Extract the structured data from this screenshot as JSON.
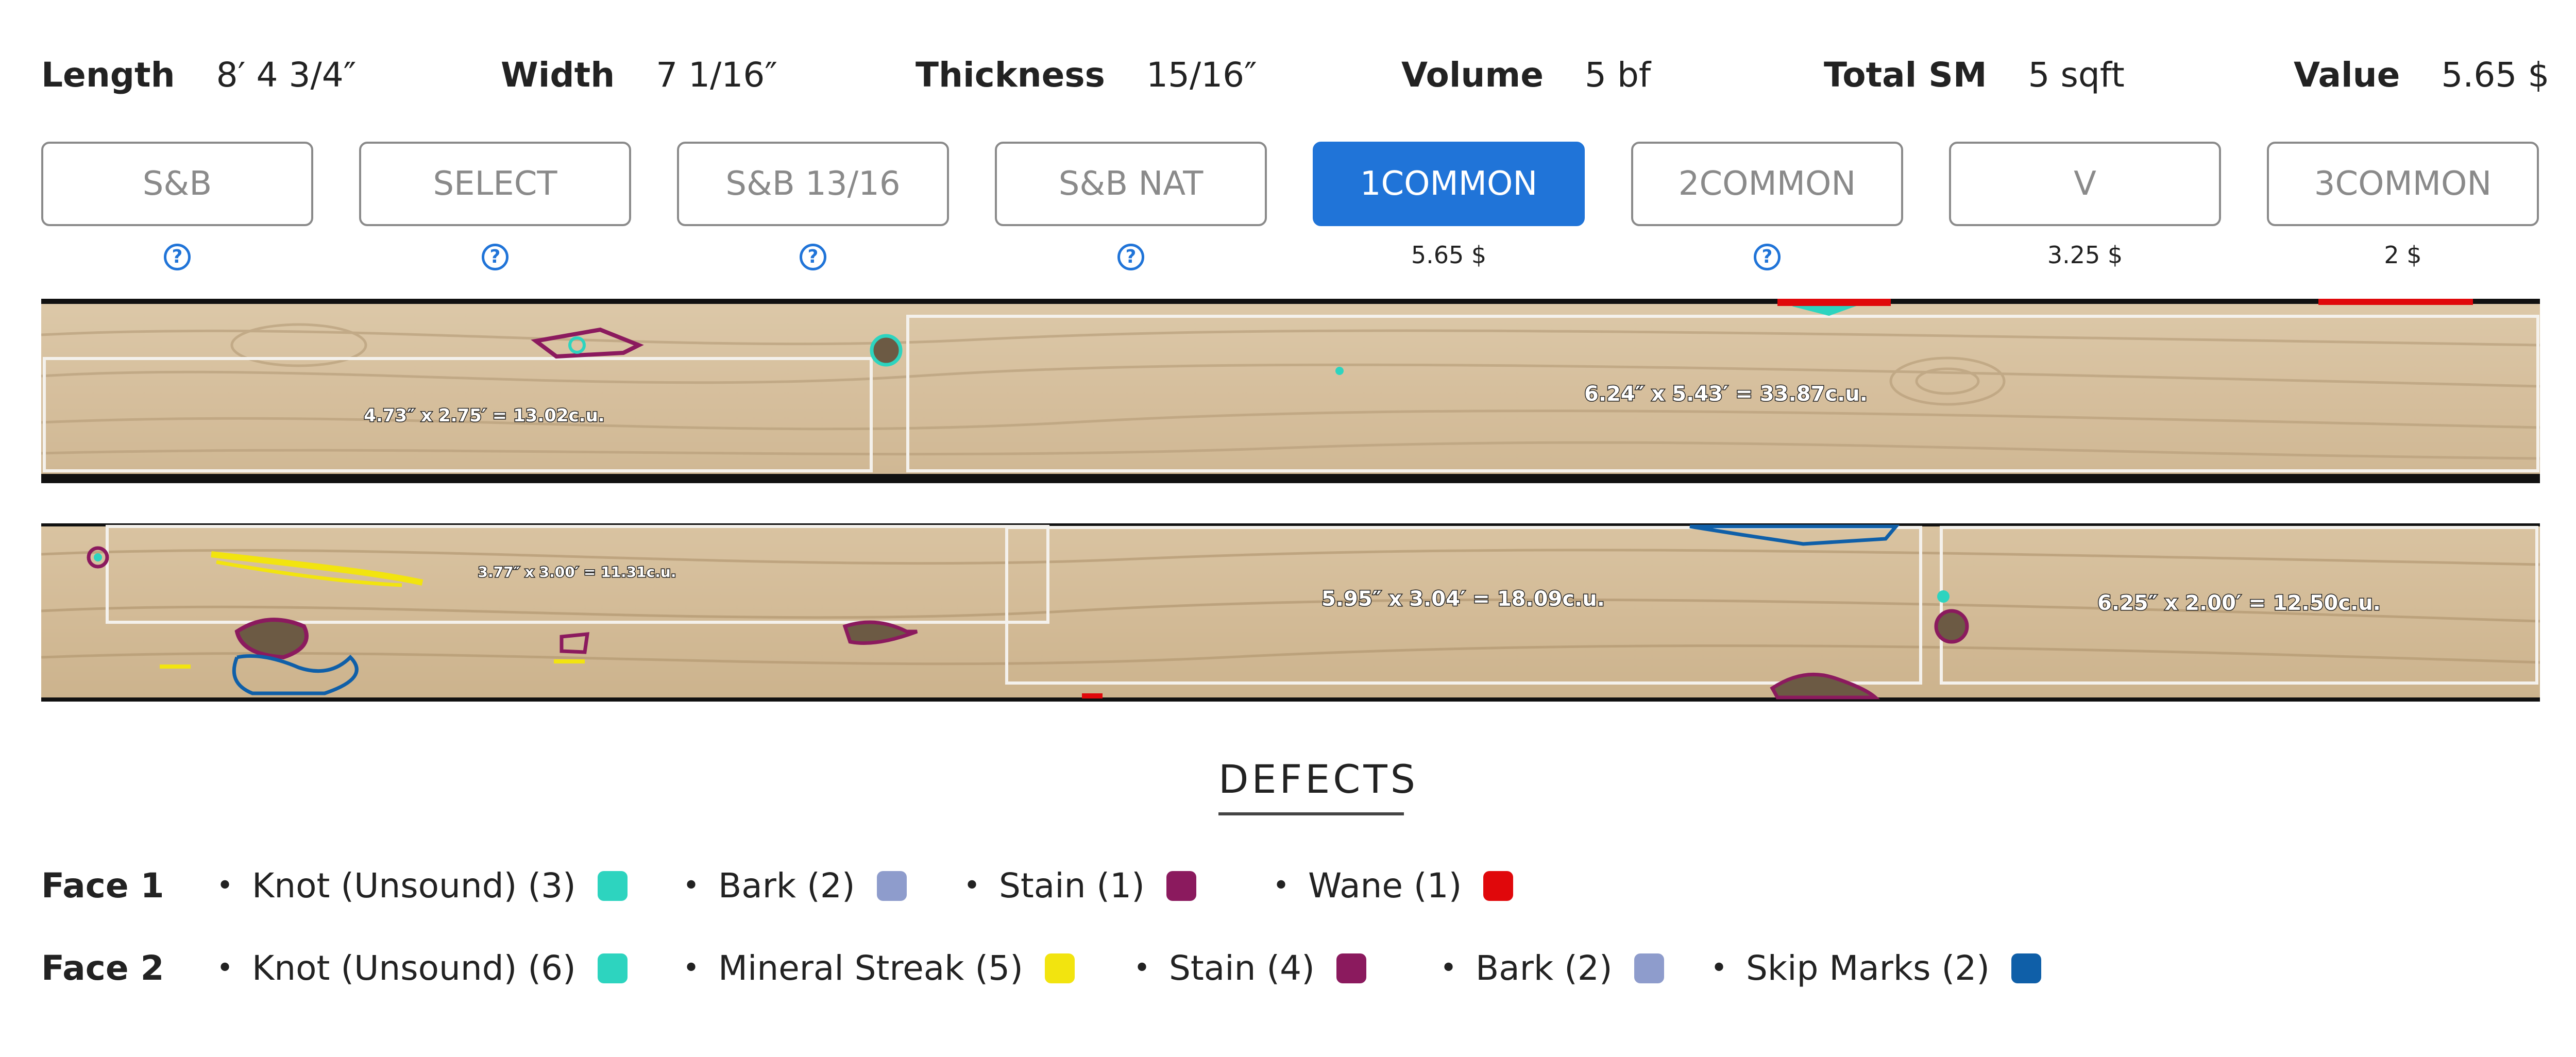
{
  "stats": [
    {
      "label": "Length",
      "value": "8′ 4 3/4″"
    },
    {
      "label": "Width",
      "value": "7 1/16″"
    },
    {
      "label": "Thickness",
      "value": "15/16″"
    },
    {
      "label": "Volume",
      "value": "5 bf"
    },
    {
      "label": "Total SM",
      "value": "5 sqft"
    },
    {
      "label": "Value",
      "value": "5.65 $"
    }
  ],
  "grades": [
    {
      "label": "S&B",
      "sub": "?",
      "help": true,
      "active": false
    },
    {
      "label": "SELECT",
      "sub": "?",
      "help": true,
      "active": false
    },
    {
      "label": "S&B 13/16",
      "sub": "?",
      "help": true,
      "active": false
    },
    {
      "label": "S&B NAT",
      "sub": "?",
      "help": true,
      "active": false
    },
    {
      "label": "1COMMON",
      "sub": "5.65 $",
      "help": false,
      "active": true
    },
    {
      "label": "2COMMON",
      "sub": "?",
      "help": true,
      "active": false
    },
    {
      "label": "V",
      "sub": "3.25 $",
      "help": false,
      "active": false
    },
    {
      "label": "3COMMON",
      "sub": "2 $",
      "help": false,
      "active": false
    }
  ],
  "board_face1": {
    "cuts": [
      {
        "label": "4.73″ x 2.75′ = 13.02c.u."
      },
      {
        "label": "6.24″ x 5.43′ = 33.87c.u."
      }
    ]
  },
  "board_face2": {
    "cuts": [
      {
        "label": "3.77″ x 3.00′ = 11.31c.u."
      },
      {
        "label": "5.95″ x 3.04′ = 18.09c.u."
      },
      {
        "label": "6.25″ x 2.00′ = 12.50c.u."
      }
    ]
  },
  "defects": {
    "title": "DEFECTS",
    "faces": [
      {
        "label": "Face 1",
        "items": [
          {
            "text": "Knot (Unsound) (3)",
            "color": "#2dd4bf"
          },
          {
            "text": "Bark (2)",
            "color": "#8e9ccc"
          },
          {
            "text": "Stain (1)",
            "color": "#8b1a5e"
          },
          {
            "text": "Wane (1)",
            "color": "#e0080b"
          }
        ]
      },
      {
        "label": "Face 2",
        "items": [
          {
            "text": "Knot (Unsound) (6)",
            "color": "#2dd4bf"
          },
          {
            "text": "Mineral Streak (5)",
            "color": "#f2e40f"
          },
          {
            "text": "Stain (4)",
            "color": "#8b1a5e"
          },
          {
            "text": "Bark (2)",
            "color": "#8e9ccc"
          },
          {
            "text": "Skip Marks (2)",
            "color": "#0f5fa8"
          }
        ]
      }
    ]
  },
  "colors": {
    "accent": "#2074d8",
    "board_wood": "#d9c4a4",
    "cut_outline": "#f4f1ec"
  }
}
